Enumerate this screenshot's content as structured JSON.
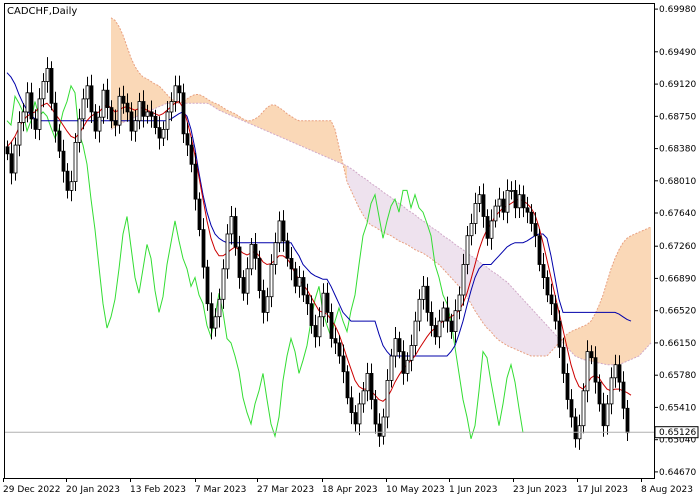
{
  "title": "CADCHF,Daily",
  "colors": {
    "background": "#ffffff",
    "axis": "#000000",
    "candle": "#000000",
    "tenkan": "#cc0000",
    "kijun": "#0000aa",
    "chikou": "#33dd33",
    "senkou_a": "#e8a080",
    "senkou_b": "#d0a8c8",
    "cloud_bull": "#f09030",
    "cloud_bear": "#c8a0c8",
    "current_line": "#b0b0b0"
  },
  "current_price_label": "0.65126",
  "chart_data": {
    "type": "candlestick",
    "title": "CADCHF,Daily",
    "ylim": [
      0.646,
      0.7005
    ],
    "y_ticks": [
      "0.69980",
      "0.69490",
      "0.69120",
      "0.68750",
      "0.68380",
      "0.68010",
      "0.67640",
      "0.67260",
      "0.66890",
      "0.66520",
      "0.66150",
      "0.65780",
      "0.65410",
      "0.65040",
      "0.64670"
    ],
    "x_ticks": [
      "29 Dec 2022",
      "20 Jan 2023",
      "13 Feb 2023",
      "7 Mar 2023",
      "27 Mar 2023",
      "18 Apr 2023",
      "10 May 2023",
      "1 Jun 2023",
      "23 Jun 2023",
      "17 Jul 2023",
      "8 Aug 2023"
    ],
    "current_price": 0.65126,
    "close": [
      0.6832,
      0.681,
      0.6842,
      0.6868,
      0.688,
      0.6902,
      0.6872,
      0.686,
      0.6895,
      0.6915,
      0.693,
      0.689,
      0.6858,
      0.6835,
      0.6812,
      0.679,
      0.68,
      0.6845,
      0.6872,
      0.6895,
      0.691,
      0.688,
      0.6858,
      0.6874,
      0.6905,
      0.6885,
      0.687,
      0.6865,
      0.6898,
      0.689,
      0.688,
      0.6858,
      0.687,
      0.6892,
      0.6875,
      0.688,
      0.6875,
      0.6862,
      0.685,
      0.686,
      0.688,
      0.6892,
      0.691,
      0.6902,
      0.6855,
      0.6842,
      0.682,
      0.678,
      0.6745,
      0.6702,
      0.666,
      0.6632,
      0.6645,
      0.6665,
      0.67,
      0.674,
      0.676,
      0.6725,
      0.669,
      0.6672,
      0.67,
      0.6728,
      0.6712,
      0.6675,
      0.665,
      0.6668,
      0.6705,
      0.673,
      0.6755,
      0.6732,
      0.6712,
      0.67,
      0.668,
      0.669,
      0.667,
      0.666,
      0.6635,
      0.6622,
      0.6645,
      0.6672,
      0.665,
      0.662,
      0.6615,
      0.66,
      0.6582,
      0.6552,
      0.6535,
      0.6522,
      0.6545,
      0.656,
      0.658,
      0.655,
      0.6522,
      0.6508,
      0.653,
      0.6572,
      0.66,
      0.662,
      0.6605,
      0.658,
      0.6595,
      0.6612,
      0.664,
      0.6665,
      0.668,
      0.665,
      0.6635,
      0.6622,
      0.664,
      0.6655,
      0.664,
      0.6628,
      0.6652,
      0.667,
      0.6705,
      0.6738,
      0.6752,
      0.6775,
      0.6785,
      0.676,
      0.6735,
      0.6755,
      0.6772,
      0.678,
      0.6765,
      0.679,
      0.679,
      0.677,
      0.6785,
      0.677,
      0.6765,
      0.6752,
      0.6738,
      0.6705,
      0.669,
      0.667,
      0.666,
      0.664,
      0.661,
      0.658,
      0.655,
      0.653,
      0.6505,
      0.652,
      0.656,
      0.6605,
      0.6598,
      0.657,
      0.6545,
      0.652,
      0.6545,
      0.6575,
      0.659,
      0.657,
      0.654,
      0.6512
    ],
    "tenkan": [
      0.684,
      0.6845,
      0.6852,
      0.6862,
      0.687,
      0.6875,
      0.6878,
      0.688,
      0.6885,
      0.6888,
      0.689,
      0.6885,
      0.6878,
      0.6872,
      0.6865,
      0.6858,
      0.6852,
      0.685,
      0.6855,
      0.6862,
      0.687,
      0.6875,
      0.6878,
      0.688,
      0.6885,
      0.6888,
      0.6885,
      0.688,
      0.6882,
      0.6885,
      0.6886,
      0.6884,
      0.6882,
      0.6884,
      0.6885,
      0.6882,
      0.688,
      0.6878,
      0.6876,
      0.6878,
      0.6882,
      0.6886,
      0.689,
      0.6892,
      0.6885,
      0.687,
      0.6852,
      0.683,
      0.6805,
      0.678,
      0.6755,
      0.6735,
      0.6722,
      0.6715,
      0.6715,
      0.6718,
      0.6722,
      0.6725,
      0.6722,
      0.6718,
      0.6716,
      0.6718,
      0.672,
      0.6715,
      0.6708,
      0.6705,
      0.6706,
      0.671,
      0.6715,
      0.6715,
      0.6712,
      0.6705,
      0.6695,
      0.6688,
      0.6682,
      0.6676,
      0.6668,
      0.666,
      0.6652,
      0.665,
      0.6648,
      0.6642,
      0.6635,
      0.6625,
      0.6612,
      0.6598,
      0.6585,
      0.6572,
      0.6565,
      0.6562,
      0.6562,
      0.656,
      0.6555,
      0.655,
      0.6548,
      0.6552,
      0.656,
      0.657,
      0.6578,
      0.6585,
      0.659,
      0.6595,
      0.66,
      0.6608,
      0.6615,
      0.6622,
      0.6628,
      0.6632,
      0.6636,
      0.664,
      0.6642,
      0.6645,
      0.6648,
      0.6652,
      0.666,
      0.6672,
      0.6688,
      0.6705,
      0.6722,
      0.6735,
      0.6745,
      0.6752,
      0.676,
      0.6765,
      0.677,
      0.6772,
      0.6775,
      0.6778,
      0.678,
      0.6778,
      0.6775,
      0.677,
      0.6762,
      0.6748,
      0.673,
      0.671,
      0.669,
      0.667,
      0.665,
      0.663,
      0.661,
      0.659,
      0.6575,
      0.6565,
      0.6562,
      0.6568,
      0.6575,
      0.6578,
      0.6575,
      0.6568,
      0.6562,
      0.656,
      0.6562,
      0.6562,
      0.656,
      0.6558,
      0.6555
    ],
    "kijun": [
      0.6925,
      0.692,
      0.6912,
      0.69,
      0.689,
      0.6882,
      0.6876,
      0.6872,
      0.687,
      0.687,
      0.687,
      0.687,
      0.687,
      0.687,
      0.687,
      0.687,
      0.687,
      0.687,
      0.687,
      0.687,
      0.687,
      0.687,
      0.687,
      0.687,
      0.687,
      0.687,
      0.687,
      0.687,
      0.687,
      0.687,
      0.687,
      0.687,
      0.687,
      0.687,
      0.687,
      0.687,
      0.687,
      0.687,
      0.687,
      0.687,
      0.687,
      0.6872,
      0.6875,
      0.6878,
      0.688,
      0.6875,
      0.686,
      0.6838,
      0.681,
      0.6785,
      0.6765,
      0.675,
      0.674,
      0.6735,
      0.6732,
      0.673,
      0.673,
      0.673,
      0.673,
      0.673,
      0.673,
      0.673,
      0.673,
      0.673,
      0.673,
      0.673,
      0.673,
      0.673,
      0.673,
      0.673,
      0.673,
      0.673,
      0.6722,
      0.6715,
      0.6705,
      0.67,
      0.6695,
      0.6692,
      0.669,
      0.6688,
      0.6688,
      0.668,
      0.667,
      0.666,
      0.665,
      0.6645,
      0.664,
      0.664,
      0.664,
      0.664,
      0.664,
      0.664,
      0.664,
      0.6625,
      0.6612,
      0.6605,
      0.66,
      0.66,
      0.66,
      0.66,
      0.66,
      0.66,
      0.66,
      0.66,
      0.66,
      0.66,
      0.66,
      0.66,
      0.66,
      0.66,
      0.66,
      0.6605,
      0.6612,
      0.6625,
      0.664,
      0.6658,
      0.6675,
      0.669,
      0.67,
      0.6705,
      0.6705,
      0.6705,
      0.671,
      0.6715,
      0.672,
      0.6725,
      0.6728,
      0.673,
      0.673,
      0.673,
      0.6732,
      0.6735,
      0.6738,
      0.674,
      0.674,
      0.6735,
      0.6715,
      0.669,
      0.6665,
      0.665,
      0.665,
      0.665,
      0.665,
      0.665,
      0.665,
      0.665,
      0.665,
      0.665,
      0.665,
      0.665,
      0.665,
      0.665,
      0.665,
      0.6648,
      0.6645,
      0.6642,
      0.664
    ],
    "senkou_a": [
      0.6988,
      0.6985,
      0.6978,
      0.6968,
      0.6955,
      0.6942,
      0.6932,
      0.6925,
      0.692,
      0.6918,
      0.6915,
      0.6912,
      0.691,
      0.6905,
      0.69,
      0.6895,
      0.6892,
      0.689,
      0.6892,
      0.6895,
      0.6898,
      0.69,
      0.69,
      0.6898,
      0.6895,
      0.6892,
      0.689,
      0.6888,
      0.6885,
      0.6882,
      0.688,
      0.6878,
      0.6875,
      0.6872,
      0.687,
      0.687,
      0.6872,
      0.6875,
      0.688,
      0.6885,
      0.6888,
      0.6888,
      0.6885,
      0.6882,
      0.6878,
      0.6875,
      0.6872,
      0.687,
      0.687,
      0.687,
      0.687,
      0.687,
      0.687,
      0.687,
      0.687,
      0.687,
      0.686,
      0.684,
      0.682,
      0.68,
      0.679,
      0.678,
      0.677,
      0.6762,
      0.6755,
      0.675,
      0.6748,
      0.6745,
      0.6742,
      0.674,
      0.6738,
      0.6735,
      0.6732,
      0.673,
      0.6728,
      0.6725,
      0.6722,
      0.672,
      0.6718,
      0.6715,
      0.6712,
      0.6708,
      0.6705,
      0.67,
      0.6695,
      0.669,
      0.6685,
      0.668,
      0.6675,
      0.6668,
      0.666,
      0.6652,
      0.6645,
      0.6638,
      0.6632,
      0.6628,
      0.6622,
      0.6618,
      0.6615,
      0.6612,
      0.661,
      0.6608,
      0.6606,
      0.6604,
      0.6602,
      0.66,
      0.66,
      0.66,
      0.66,
      0.66,
      0.6605,
      0.661,
      0.6615,
      0.662,
      0.6625,
      0.6628,
      0.663,
      0.6632,
      0.6634,
      0.6636,
      0.664,
      0.6648,
      0.6658,
      0.667,
      0.6685,
      0.67,
      0.6712,
      0.6722,
      0.673,
      0.6735,
      0.6738,
      0.674,
      0.6742,
      0.6744,
      0.6746,
      0.6748,
      0.675,
      0.6752,
      0.6754,
      0.6755,
      0.6756,
      0.6757,
      0.6758,
      0.6759,
      0.676,
      0.6761,
      0.6762,
      0.6763,
      0.6764,
      0.6765,
      0.6766,
      0.6767,
      0.6768,
      0.6769,
      0.677,
      0.6771,
      0.6771,
      0.6772,
      0.6772,
      0.6773
    ],
    "senkou_b": [
      0.686,
      0.6862,
      0.6865,
      0.6868,
      0.687,
      0.6872,
      0.6874,
      0.6876,
      0.6878,
      0.688,
      0.6882,
      0.6884,
      0.6886,
      0.6888,
      0.689,
      0.689,
      0.689,
      0.689,
      0.689,
      0.689,
      0.689,
      0.689,
      0.689,
      0.689,
      0.689,
      0.6888,
      0.6885,
      0.6882,
      0.688,
      0.6878,
      0.6876,
      0.6874,
      0.6872,
      0.687,
      0.6868,
      0.6866,
      0.6864,
      0.6862,
      0.686,
      0.6858,
      0.6856,
      0.6854,
      0.6852,
      0.685,
      0.6848,
      0.6846,
      0.6844,
      0.6842,
      0.684,
      0.6838,
      0.6836,
      0.6834,
      0.6832,
      0.683,
      0.6828,
      0.6826,
      0.6824,
      0.6822,
      0.682,
      0.6818,
      0.6815,
      0.6812,
      0.6808,
      0.6805,
      0.6802,
      0.6798,
      0.6795,
      0.6792,
      0.6788,
      0.6785,
      0.6782,
      0.6778,
      0.6775,
      0.6772,
      0.6768,
      0.6765,
      0.6762,
      0.6758,
      0.6755,
      0.6752,
      0.6748,
      0.6745,
      0.6742,
      0.6738,
      0.6735,
      0.6732,
      0.6728,
      0.6725,
      0.6722,
      0.6718,
      0.6715,
      0.6712,
      0.6708,
      0.6705,
      0.6702,
      0.6698,
      0.6695,
      0.6692,
      0.6688,
      0.6685,
      0.668,
      0.6675,
      0.667,
      0.6665,
      0.666,
      0.6655,
      0.665,
      0.6645,
      0.664,
      0.6635,
      0.663,
      0.6625,
      0.662,
      0.6615,
      0.661,
      0.6605,
      0.66,
      0.6598,
      0.6596,
      0.6595,
      0.6594,
      0.6593,
      0.6592,
      0.6591,
      0.659,
      0.659,
      0.659,
      0.659,
      0.6592,
      0.6594,
      0.6596,
      0.6598,
      0.66,
      0.6605,
      0.661,
      0.6615,
      0.662,
      0.6625,
      0.663,
      0.6635,
      0.664,
      0.6645,
      0.6648,
      0.665,
      0.665,
      0.665,
      0.665,
      0.665,
      0.665,
      0.665,
      0.665,
      0.665,
      0.665,
      0.665,
      0.665,
      0.665,
      0.665,
      0.665,
      0.665
    ]
  }
}
